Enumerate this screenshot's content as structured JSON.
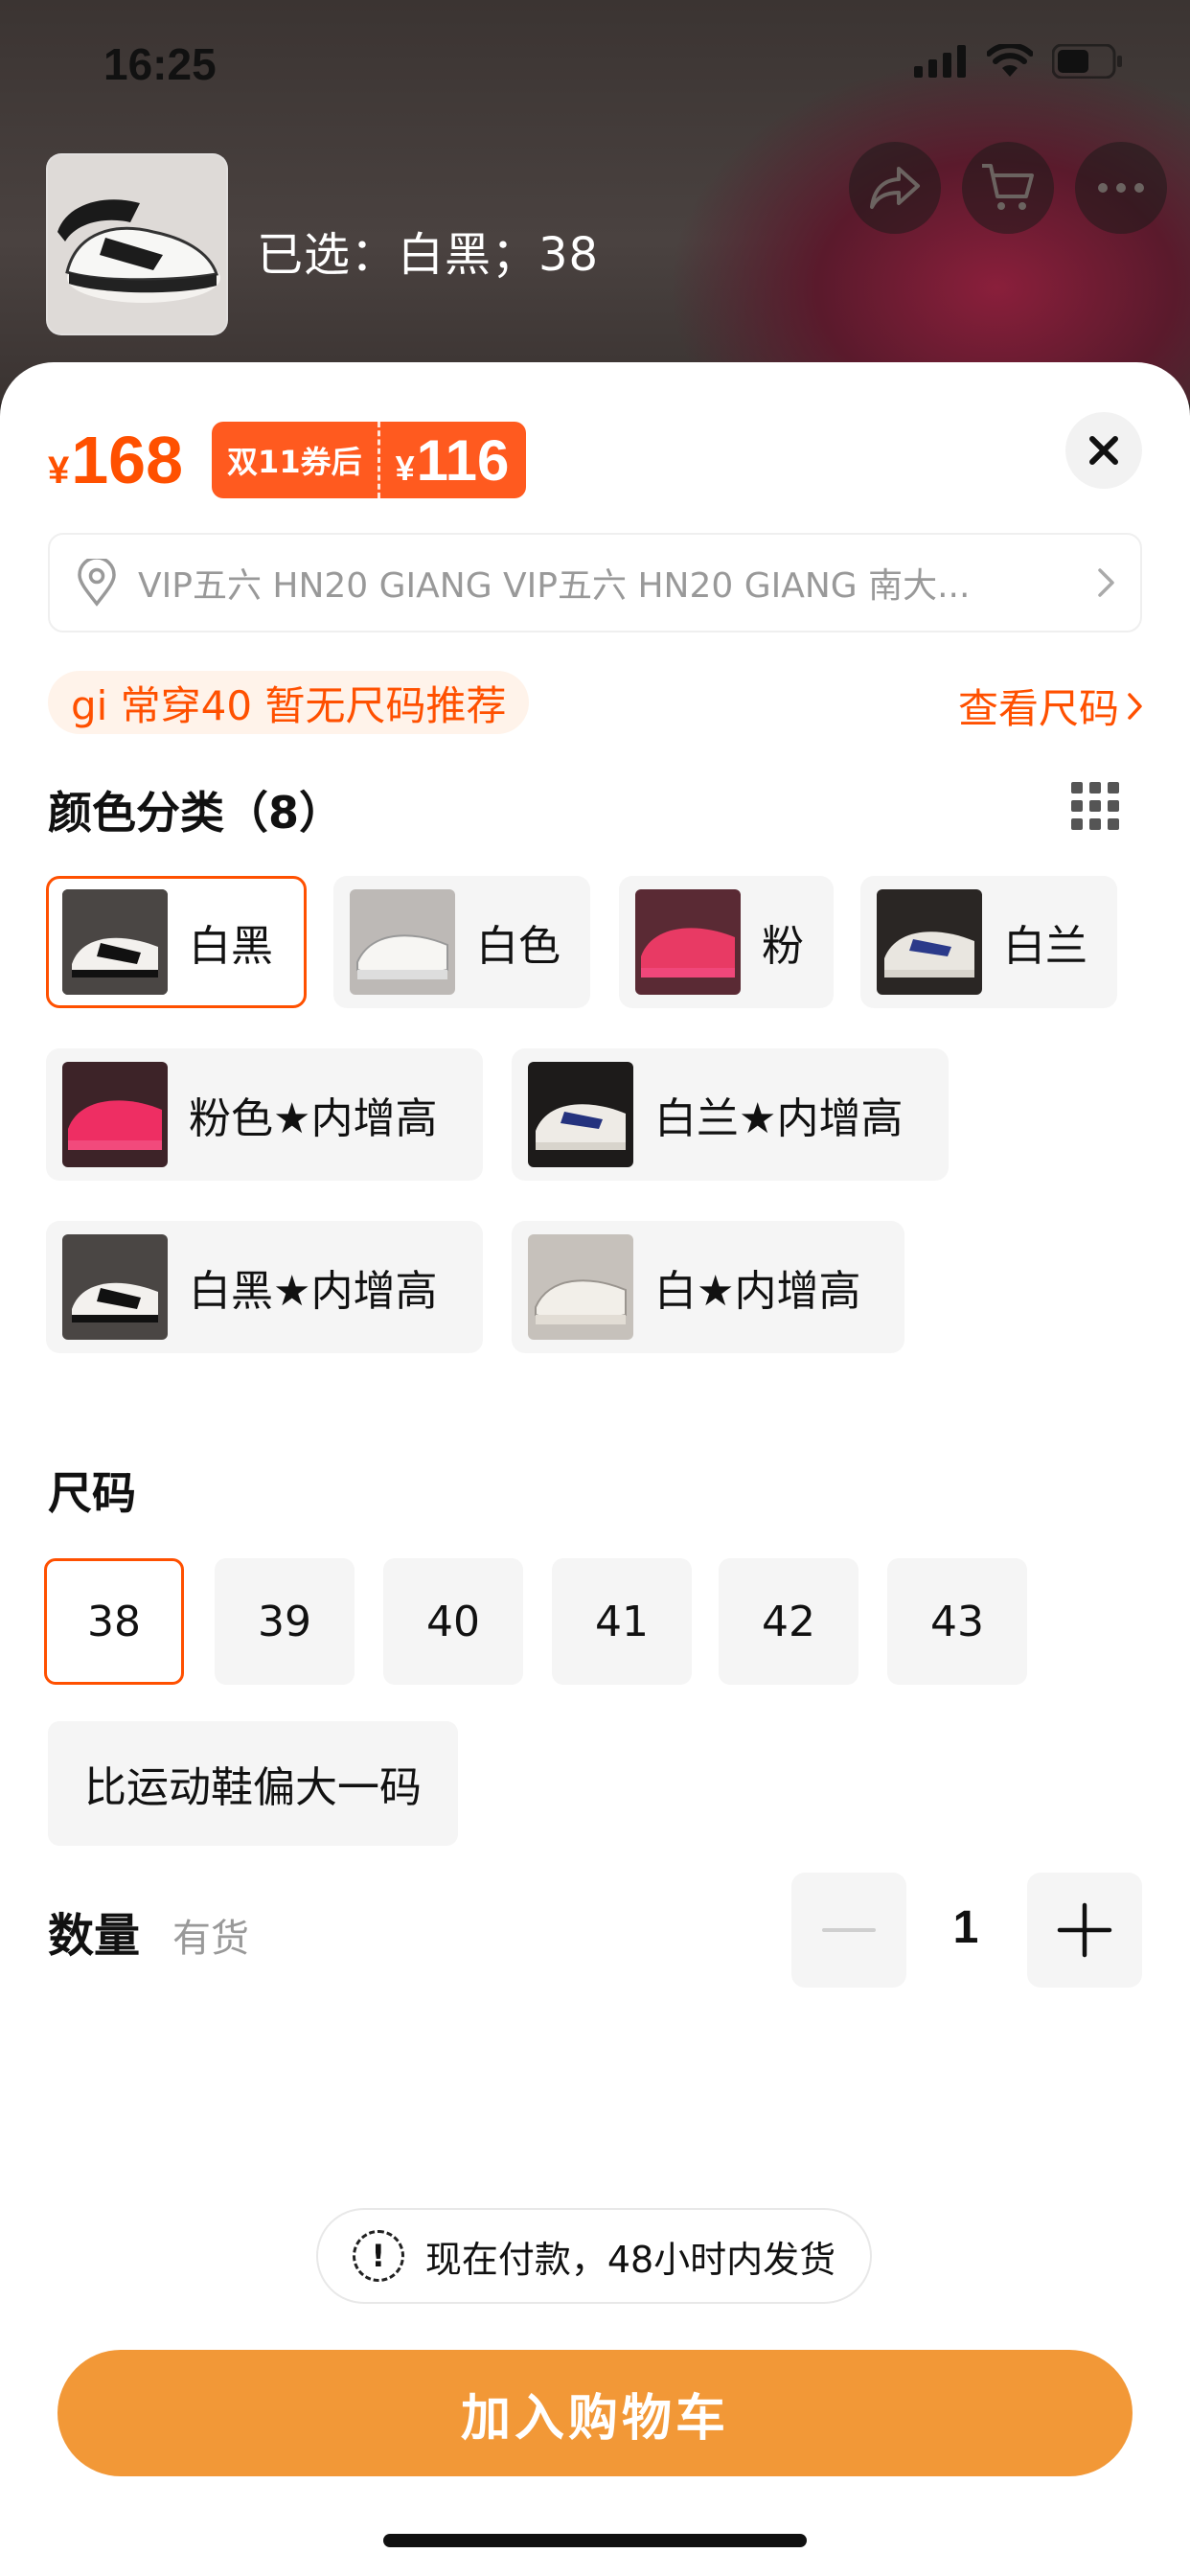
{
  "status_bar": {
    "time": "16:25"
  },
  "header": {
    "selected_text": "已选：白黑；38"
  },
  "price": {
    "currency": "¥",
    "original": "168",
    "coupon_label": "双11券后",
    "coupon_price": "116"
  },
  "address": {
    "text": "VIP五六 HN20 GIANG VIP五六 HN20 GIANG 南大..."
  },
  "recommend": {
    "text": "gi 常穿40 暂无尺码推荐",
    "size_link": "查看尺码"
  },
  "colors": {
    "title": "颜色分类（8）",
    "items": [
      {
        "label": "白黑",
        "selected": true,
        "swatch": "white-black"
      },
      {
        "label": "白色",
        "selected": false,
        "swatch": "white"
      },
      {
        "label": "粉",
        "selected": false,
        "swatch": "pink"
      },
      {
        "label": "白兰",
        "selected": false,
        "swatch": "white-blue"
      },
      {
        "label": "粉色★内增高",
        "selected": false,
        "swatch": "pink"
      },
      {
        "label": "白兰★内增高",
        "selected": false,
        "swatch": "white-blue"
      },
      {
        "label": "白黑★内增高",
        "selected": false,
        "swatch": "white-black"
      },
      {
        "label": "白★内增高",
        "selected": false,
        "swatch": "white"
      }
    ]
  },
  "sizes": {
    "title": "尺码",
    "items": [
      "38",
      "39",
      "40",
      "41",
      "42",
      "43"
    ],
    "selected": "38",
    "fit_note": "比运动鞋偏大一码"
  },
  "quantity": {
    "label": "数量",
    "stock": "有货",
    "value": "1"
  },
  "notice": {
    "icon": "!",
    "text": "现在付款，48小时内发货"
  },
  "actions": {
    "add_to_cart": "加入购物车"
  },
  "colors_theme": {
    "accent": "#ff5000",
    "button": "#f29837"
  }
}
